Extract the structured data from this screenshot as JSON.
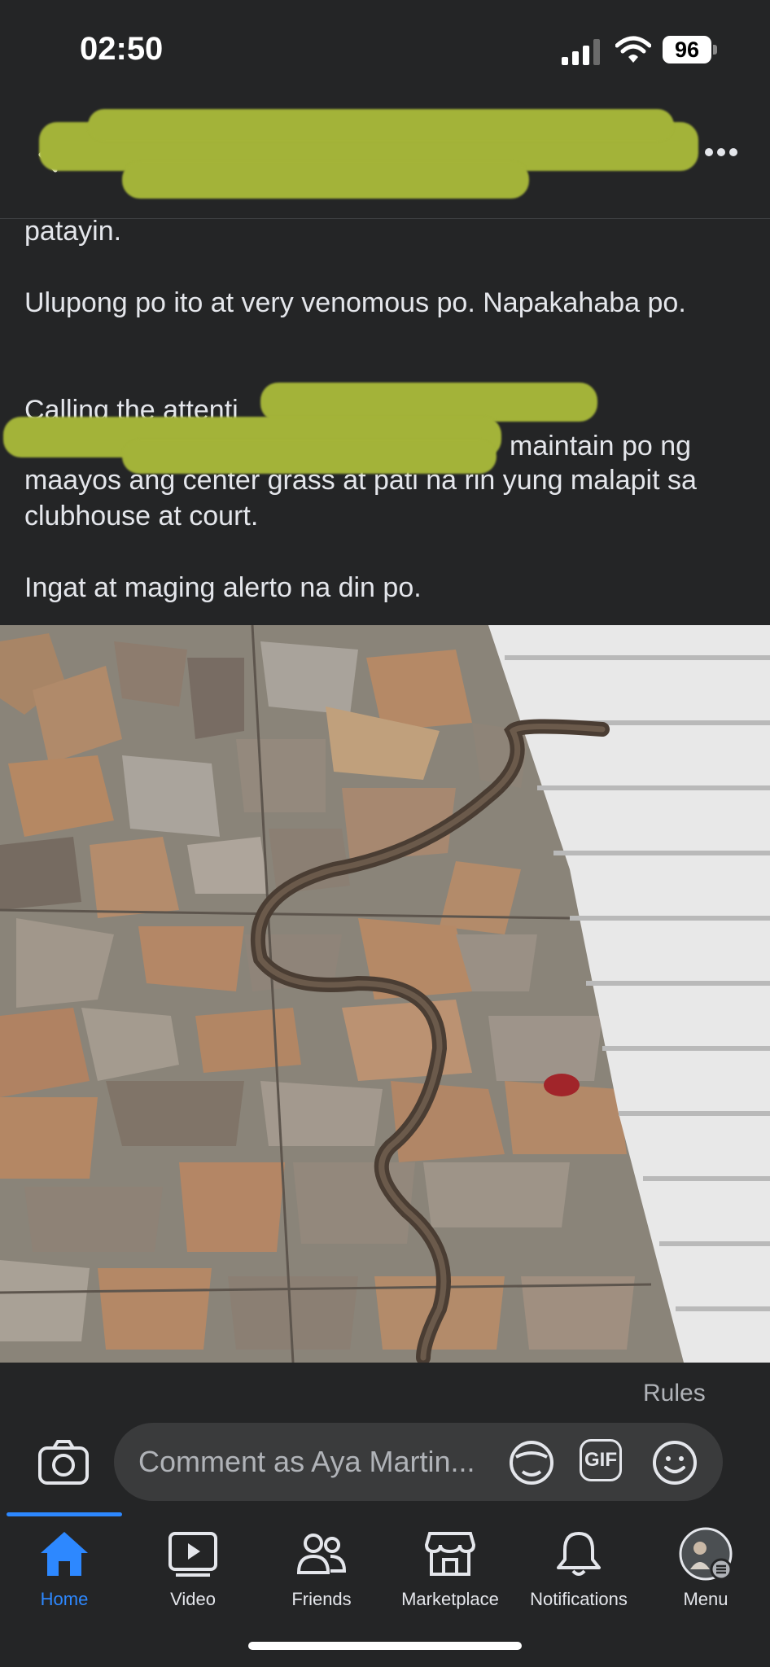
{
  "status": {
    "time": "02:50",
    "battery": "96"
  },
  "post": {
    "line1": "patayin.",
    "para2": "Ulupong po ito at very venomous po. Napakahaba po.",
    "para3_start": "Calling the attenti",
    "para3_line2_end": "maintain po ng",
    "para3_rest": "maayos ang center grass at pati na rin yung malapit sa clubhouse at court.",
    "para4": "Ingat at maging alerto na din po."
  },
  "rules_link": "Rules",
  "comment": {
    "placeholder": "Comment as Aya Martin...",
    "gif_label": "GIF"
  },
  "tabs": [
    {
      "label": "Home",
      "icon": "home-icon",
      "active": true
    },
    {
      "label": "Video",
      "icon": "video-icon"
    },
    {
      "label": "Friends",
      "icon": "friends-icon"
    },
    {
      "label": "Marketplace",
      "icon": "marketplace-icon"
    },
    {
      "label": "Notifications",
      "icon": "bell-icon"
    },
    {
      "label": "Menu",
      "icon": "profile-avatar"
    }
  ],
  "colors": {
    "background": "#242526",
    "accent": "#2d88ff",
    "redaction": "#a3b339"
  }
}
